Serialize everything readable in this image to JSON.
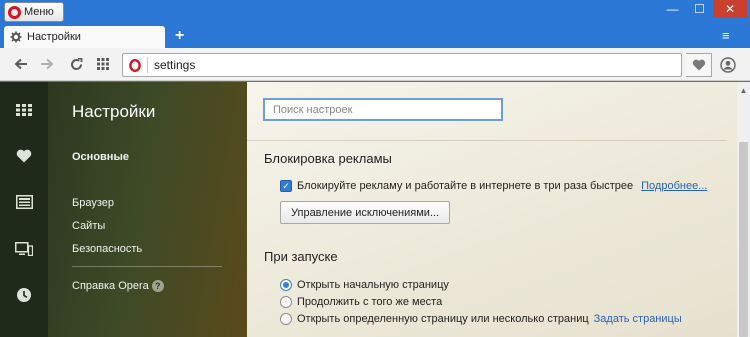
{
  "window": {
    "menu_label": "Меню",
    "controls": {
      "minimize": "—",
      "maximize": "☐",
      "close": "✕"
    }
  },
  "tabs": {
    "active_tab_label": "Настройки",
    "new_tab_symbol": "+",
    "tab_menu_symbol": "≡"
  },
  "address_bar": {
    "url": "settings"
  },
  "sidebar": {
    "icons": [
      "speed-dial-icon",
      "heart-icon",
      "news-icon",
      "devices-icon",
      "history-icon"
    ]
  },
  "settings_nav": {
    "title": "Настройки",
    "items": [
      {
        "label": "Основные",
        "active": true
      },
      {
        "label": "Браузер",
        "active": false
      },
      {
        "label": "Сайты",
        "active": false
      },
      {
        "label": "Безопасность",
        "active": false
      }
    ],
    "help_label": "Справка Opera",
    "help_icon": "?"
  },
  "main": {
    "search_placeholder": "Поиск настроек",
    "ad_block": {
      "heading": "Блокировка рекламы",
      "checkbox_label": "Блокируйте рекламу и работайте в интернете в три раза быстрее",
      "checkbox_checked": true,
      "more_link": "Подробнее...",
      "exceptions_button": "Управление исключениями..."
    },
    "startup": {
      "heading": "При запуске",
      "options": [
        {
          "label": "Открыть начальную страницу",
          "selected": true
        },
        {
          "label": "Продолжить с того же места",
          "selected": false
        },
        {
          "label": "Открыть определенную страницу или несколько страниц",
          "selected": false
        }
      ],
      "set_pages_link": "Задать страницы"
    }
  },
  "colors": {
    "titlebar": "#2b78d6",
    "accent": "#2f7cd1",
    "opera_red": "#e0101e",
    "link": "#2a63b8"
  }
}
